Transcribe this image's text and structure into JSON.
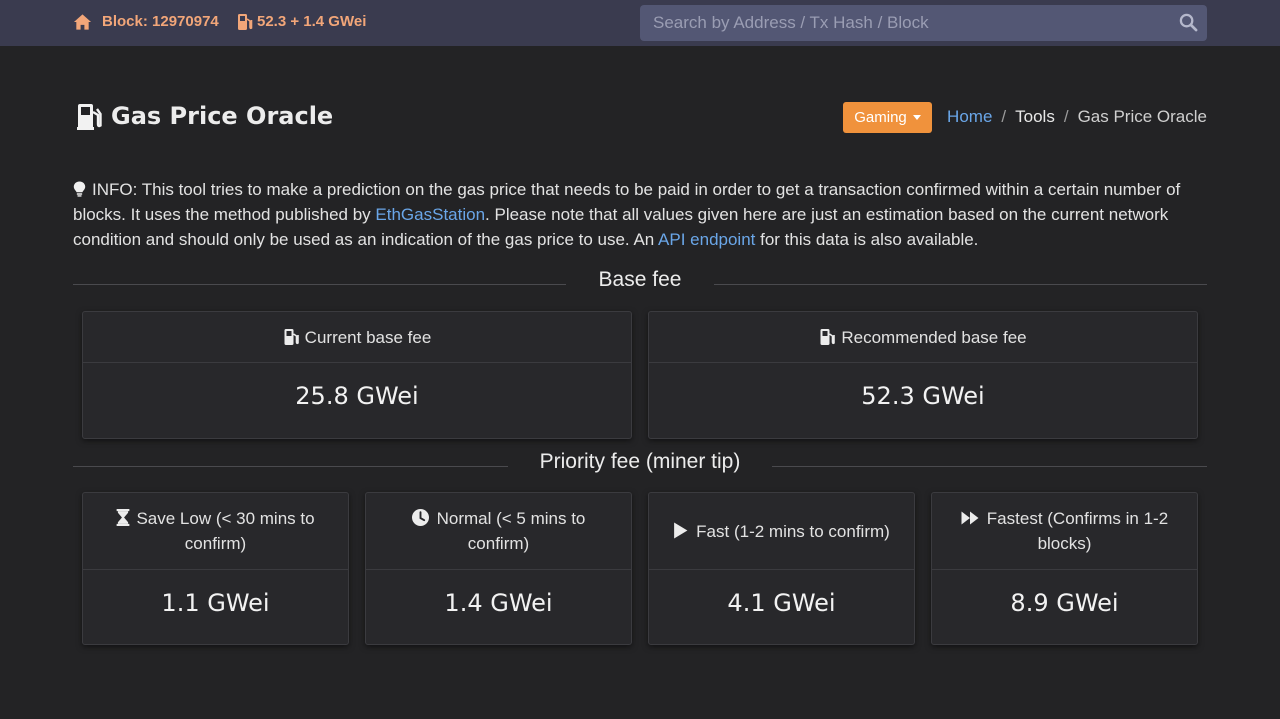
{
  "topbar": {
    "block_label": "Block: 12970974",
    "gas_label": "52.3 + 1.4 GWei",
    "search_placeholder": "Search by Address / Tx Hash / Block",
    "icons": [
      "home-icon",
      "gas-pump-icon",
      "search-icon"
    ]
  },
  "header": {
    "title": "Gas Price Oracle",
    "dropdown_label": "Gaming",
    "breadcrumb": {
      "home": "Home",
      "tools": "Tools",
      "current": "Gas Price Oracle",
      "separator": "/"
    }
  },
  "info": {
    "part1": "INFO: This tool tries to make a prediction on the gas price that needs to be paid in order to get a transaction confirmed within a certain number of blocks. It uses the method published by ",
    "link1": "EthGasStation",
    "part2": ". Please note that all values given here are just an estimation based on the current network condition and should only be used as an indication of the gas price to use. An ",
    "link2": "API endpoint",
    "part3": " for this data is also available."
  },
  "base_fee": {
    "section_title": "Base fee",
    "cards": [
      {
        "label": "Current base fee",
        "value": "25.8 GWei",
        "icon": "gas-pump-icon"
      },
      {
        "label": "Recommended base fee",
        "value": "52.3 GWei",
        "icon": "gas-pump-icon"
      }
    ]
  },
  "priority_fee": {
    "section_title": "Priority fee (miner tip)",
    "cards": [
      {
        "label": "Save Low (< 30 mins to confirm)",
        "value": "1.1 GWei",
        "icon": "hourglass-icon"
      },
      {
        "label": "Normal (< 5 mins to confirm)",
        "value": "1.4 GWei",
        "icon": "clock-icon"
      },
      {
        "label": "Fast (1-2 mins to confirm)",
        "value": "4.1 GWei",
        "icon": "play-icon"
      },
      {
        "label": "Fastest (Confirms in 1-2 blocks)",
        "value": "8.9 GWei",
        "icon": "fast-forward-icon"
      }
    ]
  },
  "colors": {
    "topbar_bg": "#3a3b4f",
    "page_bg": "#232325",
    "accent_orange": "#f0923c",
    "topbar_text": "#f2a679",
    "link": "#6aa6e8"
  }
}
